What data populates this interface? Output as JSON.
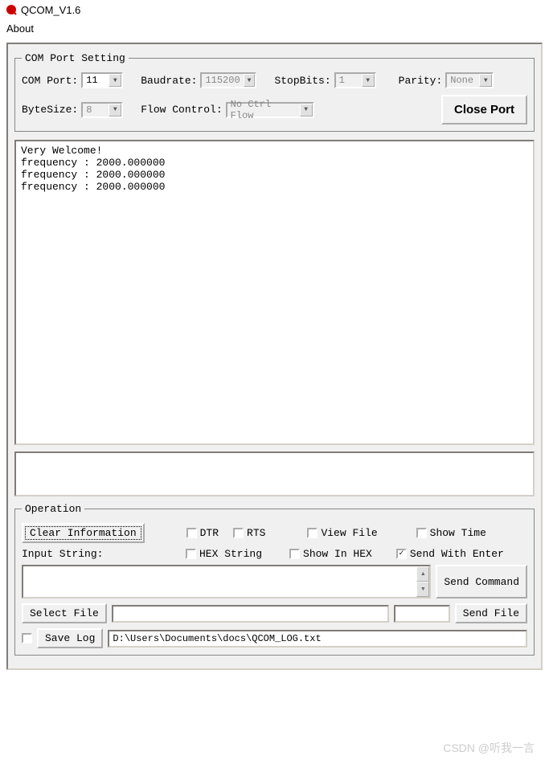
{
  "window": {
    "title": "QCOM_V1.6"
  },
  "menu": {
    "about": "About"
  },
  "com_port_setting": {
    "legend": "COM Port Setting",
    "com_port_label": "COM Port:",
    "com_port_value": "11",
    "baudrate_label": "Baudrate:",
    "baudrate_value": "115200",
    "stopbits_label": "StopBits:",
    "stopbits_value": "1",
    "parity_label": "Parity:",
    "parity_value": "None",
    "bytesize_label": "ByteSize:",
    "bytesize_value": "8",
    "flow_label": "Flow Control:",
    "flow_value": "No Ctrl Flow",
    "close_port_btn": "Close Port"
  },
  "console_text": "Very Welcome!\nfrequency : 2000.000000\nfrequency : 2000.000000\nfrequency : 2000.000000",
  "operation": {
    "legend": "Operation",
    "clear_btn": "Clear Information",
    "dtr_label": "DTR",
    "rts_label": "RTS",
    "view_file_label": "View File",
    "show_time_label": "Show Time",
    "hex_string_label": "HEX String",
    "show_in_hex_label": "Show In HEX",
    "send_with_enter_label": "Send With Enter",
    "input_string_label": "Input String:",
    "send_command_btn": "Send Command",
    "select_file_btn": "Select File",
    "send_file_btn": "Send File",
    "save_log_btn": "Save Log",
    "log_path": "D:\\Users\\Documents\\docs\\QCOM_LOG.txt",
    "checks": {
      "dtr": false,
      "rts": false,
      "view_file": false,
      "show_time": false,
      "hex_string": false,
      "show_in_hex": false,
      "send_with_enter": true,
      "save_log": false
    }
  },
  "watermark": "CSDN @听我一言"
}
